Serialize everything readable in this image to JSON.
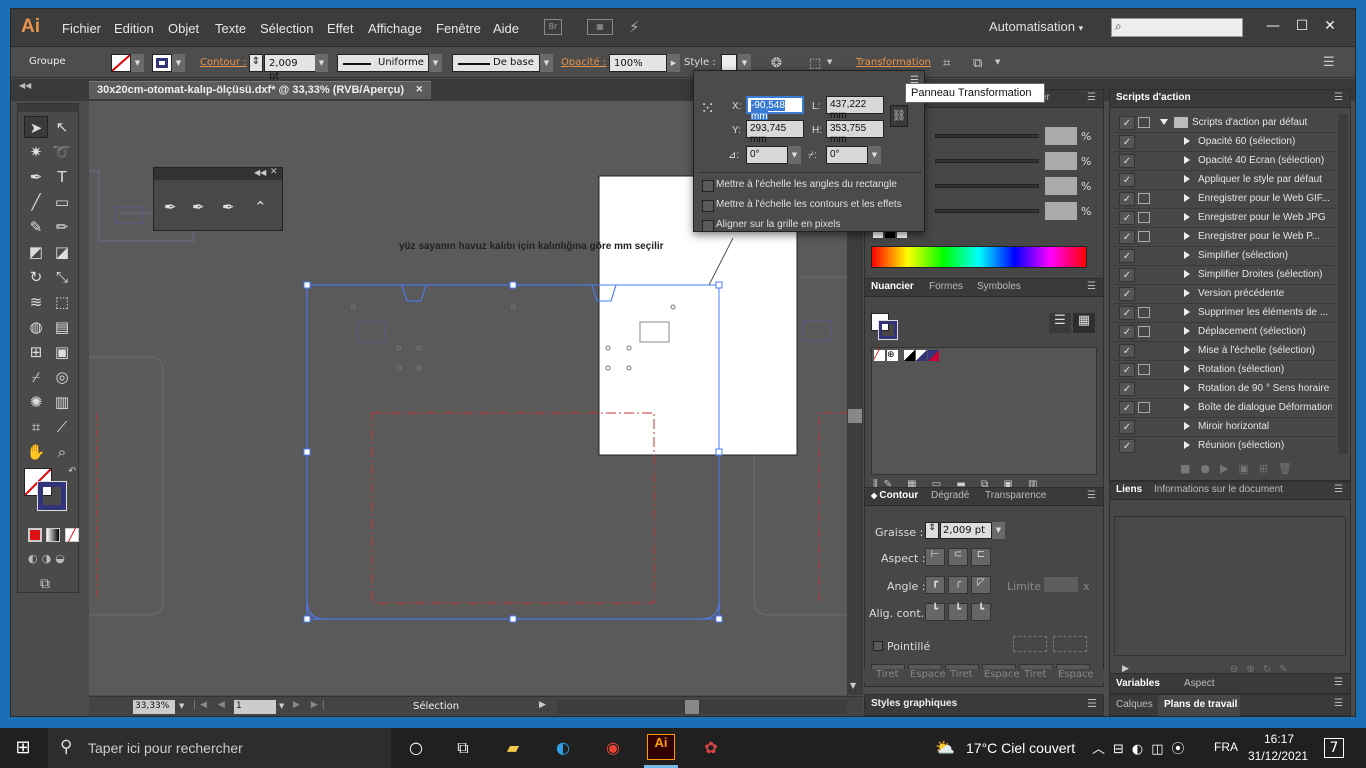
{
  "app": {
    "logo": "Ai"
  },
  "menu": [
    "Fichier",
    "Edition",
    "Objet",
    "Texte",
    "Sélection",
    "Effet",
    "Affichage",
    "Fenêtre",
    "Aide"
  ],
  "menubar": {
    "br_label": "Br",
    "workspace": "Automatisation",
    "workspace_arrow": "▾",
    "search_icon": "⌕"
  },
  "window_controls": {
    "minimize": "—",
    "restore": "☐",
    "close": "✕"
  },
  "control_bar": {
    "selection_type": "Groupe",
    "contour_label": "Contour :",
    "stroke_weight": "2,009 pt",
    "stroke_profile": "Uniforme",
    "brush": "De base",
    "opacity_label": "Opacité :",
    "opacity_value": "100%",
    "style_label": "Style :",
    "transformation_label": "Transformation"
  },
  "document_tab": {
    "title": "30x20cm-otomat-kalıp-ölçüsü.dxf* @ 33,33% (RVB/Aperçu)",
    "close": "✕"
  },
  "canvas": {
    "text_note": "yüz sayanın havuz kalıbı için kalınlığına göre mm seçilir"
  },
  "status_bar": {
    "zoom": "33,33%",
    "page": "1",
    "mode": "Sélection"
  },
  "transform_panel": {
    "x_label": "X:",
    "x_value": "-90,548 mm",
    "y_label": "Y:",
    "y_value": "293,745 mm",
    "w_label": "L:",
    "w_value": "437,222 mm",
    "h_label": "H:",
    "h_value": "353,755 mm",
    "rotate_value": "0°",
    "shear_value": "0°",
    "opt1": "Mettre à l'échelle les angles du rectangle",
    "opt2": "Mettre à l'échelle les contours et les effets",
    "opt3": "Aligner sur la grille en pixels"
  },
  "tooltip": "Panneau Transformation",
  "color_panel": {
    "percent": "%",
    "partial_label": "er"
  },
  "swatch_panel": {
    "tabs": [
      "Nuancier",
      "Formes",
      "Symboles"
    ]
  },
  "stroke_panel": {
    "tabs": [
      "Contour",
      "Dégradé",
      "Transparence"
    ],
    "graisse_label": "Graisse :",
    "graisse_value": "2,009 pt",
    "aspect_label": "Aspect :",
    "angle_label": "Angle :",
    "limite_label": "Limite :",
    "limite_unit": "x",
    "align_label": "Alig. cont.:",
    "dashed_label": "Pointillé",
    "dash_labels": [
      "Tiret",
      "Espace",
      "Tiret",
      "Espace",
      "Tiret",
      "Espace"
    ]
  },
  "styles_panel": {
    "title": "Styles graphiques"
  },
  "actions_panel": {
    "title": "Scripts d'action",
    "set_name": "Scripts d'action par défaut",
    "actions": [
      {
        "name": "Opacité 60 (sélection)",
        "dialog": false
      },
      {
        "name": "Opacité 40 Ecran (sélection)",
        "dialog": false
      },
      {
        "name": "Appliquer le style par défaut",
        "dialog": false
      },
      {
        "name": "Enregistrer pour le Web GIF...",
        "dialog": true
      },
      {
        "name": "Enregistrer pour le Web JPG",
        "dialog": true
      },
      {
        "name": "Enregistrer pour le Web P...",
        "dialog": true
      },
      {
        "name": "Simplifier (sélection)",
        "dialog": false
      },
      {
        "name": "Simplifier Droites (sélection)",
        "dialog": false
      },
      {
        "name": "Version précédente",
        "dialog": false
      },
      {
        "name": "Supprimer les éléments de ...",
        "dialog": true
      },
      {
        "name": "Déplacement (sélection)",
        "dialog": true
      },
      {
        "name": "Mise à l'échelle (sélection)",
        "dialog": false
      },
      {
        "name": "Rotation (sélection)",
        "dialog": true
      },
      {
        "name": "Rotation de 90 ° Sens horaire",
        "dialog": false
      },
      {
        "name": "Boîte de dialogue Déformation",
        "dialog": true
      },
      {
        "name": "Miroir horizontal",
        "dialog": false
      },
      {
        "name": "Réunion (sélection)",
        "dialog": false
      }
    ]
  },
  "links_panel": {
    "tabs": [
      "Liens",
      "Informations sur le document"
    ]
  },
  "variables_panel": {
    "tabs": [
      "Variables",
      "Aspect"
    ]
  },
  "layers_panel": {
    "tabs": [
      "Calques",
      "Plans de travail"
    ]
  },
  "taskbar": {
    "search_placeholder": "Taper ici pour rechercher",
    "weather": "17°C  Ciel couvert",
    "lang": "FRA",
    "time": "16:17",
    "date": "31/12/2021",
    "notifications": "7"
  }
}
